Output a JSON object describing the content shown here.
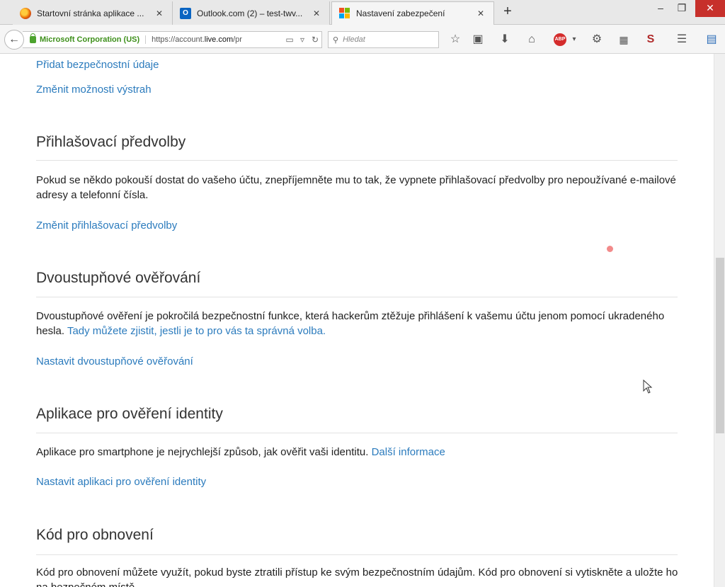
{
  "browser": {
    "tabs": [
      {
        "title": "Startovní stránka aplikace ...",
        "favicon": "firefox-icon",
        "active": false
      },
      {
        "title": "Outlook.com (2) – test-twv...",
        "favicon": "outlook-icon",
        "active": false
      },
      {
        "title": "Nastavení zabezpečení",
        "favicon": "microsoft-icon",
        "active": true
      }
    ],
    "new_tab": "+",
    "window_controls": {
      "minimize": "–",
      "restore": "❐",
      "close": "✕"
    },
    "identity": "Microsoft Corporation (US)",
    "url_prefix": "https://account.",
    "url_domain": "live.com",
    "url_suffix": "/pr",
    "search_placeholder": "Hledat",
    "colors": {
      "identity": "#3d8f1a",
      "link": "#2b7bbd",
      "close_button": "#c7302b"
    }
  },
  "page": {
    "top_links": [
      "Přidat bezpečnostní údaje",
      "Změnit možnosti výstrah"
    ],
    "sections": [
      {
        "heading": "Přihlašovací předvolby",
        "text": "Pokud se někdo pokouší dostat do vašeho účtu, znepříjemněte mu to tak, že vypnete přihlašovací předvolby pro nepoužívané e-mailové adresy a telefonní čísla.",
        "inline_link": "",
        "action_link": "Změnit přihlašovací předvolby"
      },
      {
        "heading": "Dvoustupňové ověřování",
        "text": "Dvoustupňové ověření je pokročilá bezpečnostní funkce, která hackerům ztěžuje přihlášení k vašemu účtu jenom pomocí ukradeného hesla.",
        "inline_link": "Tady můžete zjistit, jestli je to pro vás ta správná volba.",
        "action_link": "Nastavit dvoustupňové ověřování"
      },
      {
        "heading": "Aplikace pro ověření identity",
        "text": "Aplikace pro smartphone je nejrychlejší způsob, jak ověřit vaši identitu.",
        "inline_link": "Další informace",
        "action_link": "Nastavit aplikaci pro ověření identity"
      },
      {
        "heading": "Kód pro obnovení",
        "text": "Kód pro obnovení můžete využít, pokud byste ztratili přístup ke svým bezpečnostním údajům. Kód pro obnovení si vytiskněte a uložte ho na bezpečném místě.",
        "inline_link": "",
        "action_link": ""
      }
    ]
  }
}
